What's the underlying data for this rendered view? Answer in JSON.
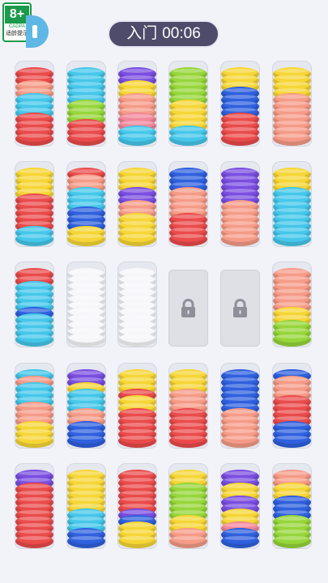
{
  "header": {
    "level_label": "入门",
    "timer": "00:06"
  },
  "age_badge": {
    "rating": "8+",
    "org": "CADPA",
    "tip": "适龄提示"
  },
  "palette": {
    "red": "#ea4b4b",
    "salmon": "#f59b87",
    "pink": "#f3869a",
    "cyan": "#45c7ea",
    "blue": "#2f60de",
    "purple": "#7a4ee0",
    "yellow": "#f6d636",
    "green": "#96d63a",
    "white": "#f7f7fb"
  },
  "board": {
    "rows": [
      [
        {
          "state": "normal",
          "rings": [
            "red",
            "red",
            "red",
            "red",
            "cyan",
            "cyan",
            "cyan",
            "salmon",
            "salmon",
            "red",
            "red"
          ]
        },
        {
          "state": "normal",
          "rings": [
            "red",
            "red",
            "red",
            "green",
            "green",
            "green",
            "cyan",
            "cyan",
            "cyan",
            "cyan",
            "cyan"
          ]
        },
        {
          "state": "normal",
          "rings": [
            "cyan",
            "cyan",
            "pink",
            "pink",
            "salmon",
            "salmon",
            "salmon",
            "yellow",
            "yellow",
            "purple",
            "purple"
          ]
        },
        {
          "state": "normal",
          "rings": [
            "cyan",
            "cyan",
            "yellow",
            "yellow",
            "yellow",
            "yellow",
            "green",
            "green",
            "green",
            "green",
            "green"
          ]
        },
        {
          "state": "normal",
          "rings": [
            "red",
            "red",
            "red",
            "red",
            "blue",
            "blue",
            "blue",
            "blue",
            "yellow",
            "yellow",
            "yellow"
          ]
        },
        {
          "state": "normal",
          "rings": [
            "salmon",
            "salmon",
            "salmon",
            "salmon",
            "salmon",
            "salmon",
            "salmon",
            "yellow",
            "yellow",
            "yellow",
            "yellow"
          ]
        }
      ],
      [
        {
          "state": "normal",
          "rings": [
            "cyan",
            "cyan",
            "red",
            "red",
            "red",
            "red",
            "red",
            "yellow",
            "yellow",
            "yellow",
            "yellow"
          ]
        },
        {
          "state": "normal",
          "rings": [
            "yellow",
            "yellow",
            "blue",
            "blue",
            "blue",
            "cyan",
            "cyan",
            "cyan",
            "salmon",
            "salmon",
            "red"
          ]
        },
        {
          "state": "normal",
          "rings": [
            "yellow",
            "yellow",
            "yellow",
            "yellow",
            "salmon",
            "salmon",
            "purple",
            "purple",
            "yellow",
            "yellow",
            "yellow"
          ]
        },
        {
          "state": "normal",
          "rings": [
            "red",
            "red",
            "red",
            "red",
            "salmon",
            "salmon",
            "salmon",
            "salmon",
            "blue",
            "blue",
            "blue"
          ]
        },
        {
          "state": "normal",
          "rings": [
            "salmon",
            "salmon",
            "salmon",
            "salmon",
            "salmon",
            "salmon",
            "purple",
            "purple",
            "purple",
            "purple",
            "purple"
          ]
        },
        {
          "state": "normal",
          "rings": [
            "cyan",
            "cyan",
            "cyan",
            "cyan",
            "cyan",
            "cyan",
            "cyan",
            "cyan",
            "yellow",
            "yellow",
            "yellow"
          ]
        }
      ],
      [
        {
          "state": "normal",
          "rings": [
            "cyan",
            "cyan",
            "cyan",
            "cyan",
            "blue",
            "cyan",
            "cyan",
            "cyan",
            "cyan",
            "red",
            "red"
          ]
        },
        {
          "state": "normal",
          "rings": [
            "white",
            "white",
            "white",
            "white",
            "white",
            "white",
            "white",
            "white",
            "white",
            "white",
            "white"
          ]
        },
        {
          "state": "normal",
          "rings": [
            "white",
            "white",
            "white",
            "white",
            "white",
            "white",
            "white",
            "white",
            "white",
            "white",
            "white"
          ]
        },
        {
          "state": "locked"
        },
        {
          "state": "locked"
        },
        {
          "state": "normal",
          "rings": [
            "green",
            "green",
            "green",
            "yellow",
            "yellow",
            "salmon",
            "salmon",
            "salmon",
            "salmon",
            "salmon",
            "salmon"
          ]
        }
      ],
      [
        {
          "state": "normal",
          "rings": [
            "yellow",
            "yellow",
            "yellow",
            "salmon",
            "salmon",
            "salmon",
            "cyan",
            "cyan",
            "cyan",
            "salmon",
            "cyan"
          ]
        },
        {
          "state": "normal",
          "rings": [
            "blue",
            "blue",
            "blue",
            "salmon",
            "salmon",
            "cyan",
            "cyan",
            "cyan",
            "yellow",
            "purple",
            "purple"
          ]
        },
        {
          "state": "normal",
          "rings": [
            "red",
            "red",
            "red",
            "red",
            "red",
            "yellow",
            "yellow",
            "red",
            "yellow",
            "yellow",
            "yellow"
          ]
        },
        {
          "state": "normal",
          "rings": [
            "red",
            "red",
            "red",
            "red",
            "red",
            "salmon",
            "salmon",
            "salmon",
            "yellow",
            "yellow",
            "yellow"
          ]
        },
        {
          "state": "normal",
          "rings": [
            "salmon",
            "salmon",
            "salmon",
            "salmon",
            "salmon",
            "blue",
            "blue",
            "blue",
            "blue",
            "blue",
            "blue"
          ]
        },
        {
          "state": "normal",
          "rings": [
            "blue",
            "blue",
            "blue",
            "red",
            "red",
            "red",
            "red",
            "salmon",
            "salmon",
            "salmon",
            "blue"
          ]
        }
      ],
      [
        {
          "state": "normal",
          "rings": [
            "red",
            "red",
            "red",
            "red",
            "red",
            "red",
            "red",
            "red",
            "red",
            "purple",
            "purple"
          ]
        },
        {
          "state": "normal",
          "rings": [
            "blue",
            "blue",
            "cyan",
            "cyan",
            "cyan",
            "yellow",
            "yellow",
            "yellow",
            "yellow",
            "yellow",
            "yellow"
          ]
        },
        {
          "state": "normal",
          "rings": [
            "yellow",
            "yellow",
            "yellow",
            "blue",
            "purple",
            "red",
            "red",
            "red",
            "red",
            "red",
            "red"
          ]
        },
        {
          "state": "normal",
          "rings": [
            "salmon",
            "salmon",
            "yellow",
            "yellow",
            "green",
            "green",
            "green",
            "green",
            "green",
            "yellow",
            "yellow"
          ]
        },
        {
          "state": "normal",
          "rings": [
            "blue",
            "blue",
            "pink",
            "yellow",
            "yellow",
            "purple",
            "purple",
            "yellow",
            "yellow",
            "purple",
            "purple"
          ]
        },
        {
          "state": "normal",
          "rings": [
            "green",
            "green",
            "green",
            "green",
            "blue",
            "blue",
            "blue",
            "yellow",
            "yellow",
            "salmon",
            "salmon"
          ]
        }
      ]
    ]
  }
}
